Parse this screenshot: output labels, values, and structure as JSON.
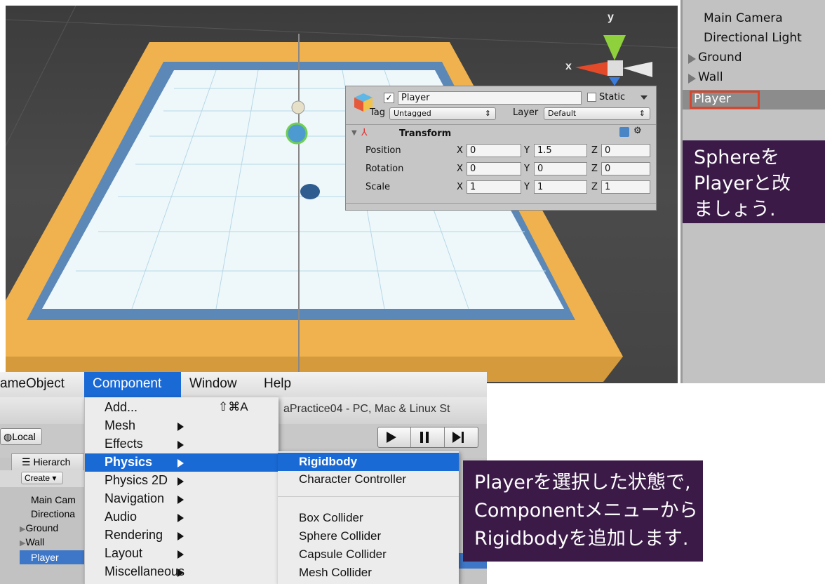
{
  "hierarchy": {
    "items": [
      {
        "label": "Main Camera",
        "arrow": false
      },
      {
        "label": "Directional Light",
        "arrow": false
      },
      {
        "label": "Ground",
        "arrow": true
      },
      {
        "label": "Wall",
        "arrow": true
      },
      {
        "label": "Player",
        "arrow": false,
        "selected": true
      }
    ]
  },
  "annotation_top": [
    "Sphereを",
    "Playerと改",
    "ましょう."
  ],
  "annotation_bottom": [
    "Playerを選択した状態で,",
    "Componentメニューから",
    "Rigidbodyを追加します."
  ],
  "inspector": {
    "name": "Player",
    "static_label": "Static",
    "tag_label": "Tag",
    "tag_value": "Untagged",
    "layer_label": "Layer",
    "layer_value": "Default",
    "component": "Transform",
    "rows": [
      {
        "label": "Position",
        "x": "0",
        "y": "1.5",
        "z": "0"
      },
      {
        "label": "Rotation",
        "x": "0",
        "y": "0",
        "z": "0"
      },
      {
        "label": "Scale",
        "x": "1",
        "y": "1",
        "z": "1"
      }
    ],
    "axis_x": "X",
    "axis_y": "Y",
    "axis_z": "Z"
  },
  "gizmo": {
    "y": "y",
    "x": "x"
  },
  "menubar": {
    "items": [
      "ameObject",
      "Component",
      "Window",
      "Help"
    ]
  },
  "component_menu": {
    "items": [
      {
        "label": "Add...",
        "shortcut": "⇧⌘A",
        "arrow": false
      },
      {
        "label": "Mesh",
        "arrow": true
      },
      {
        "label": "Effects",
        "arrow": true
      },
      {
        "label": "Physics",
        "arrow": true,
        "selected": true
      },
      {
        "label": "Physics 2D",
        "arrow": true
      },
      {
        "label": "Navigation",
        "arrow": true
      },
      {
        "label": "Audio",
        "arrow": true
      },
      {
        "label": "Rendering",
        "arrow": true
      },
      {
        "label": "Layout",
        "arrow": true
      },
      {
        "label": "Miscellaneous",
        "arrow": true
      }
    ]
  },
  "physics_submenu": {
    "items": [
      "Rigidbody",
      "Character Controller",
      "Box Collider",
      "Sphere Collider",
      "Capsule Collider",
      "Mesh Collider"
    ]
  },
  "unity_window": {
    "title": "aPractice04 - PC, Mac & Linux St",
    "local_label": "Local",
    "hier_tab": "Hierarch",
    "create_label": "Create",
    "small_hier": [
      "Main Cam",
      "Directiona",
      "Ground",
      "Wall",
      "Player"
    ]
  },
  "colors": {
    "accent": "#1a6ad6",
    "annotation_bg": "#3b1a48",
    "highlight_box": "#d8452c",
    "wall": "#f0b24e"
  }
}
